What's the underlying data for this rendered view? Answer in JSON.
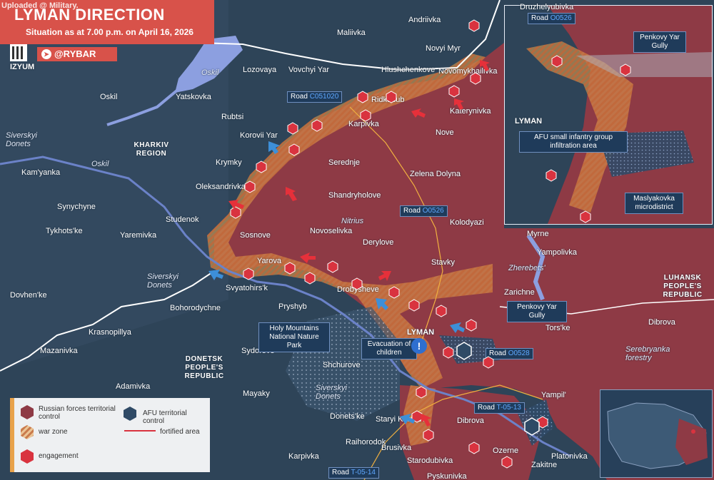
{
  "header": {
    "watermark": "Uploaded @ Military.",
    "title": "LYMAN DIRECTION",
    "subtitle": "Situation as at 7.00 p.m. on April 16, 2026",
    "brand": "@RYBAR",
    "brand_icon": "telegram-icon",
    "qr_icon": "qr-code-icon"
  },
  "colors": {
    "russian_control": "#8e3a45",
    "war_zone": "#e8a24a",
    "afu_control": "#2f4a66",
    "water": "#8c9fe0",
    "engagement": "#d9333f",
    "arrow_ru": "#e6303a",
    "arrow_afu": "#3d8fd8",
    "title_bg": "#d8524a"
  },
  "settlements": [
    {
      "name": "Druzhelyubivka"
    },
    {
      "name": "Andriivka"
    },
    {
      "name": "Maliivka"
    },
    {
      "name": "Novyi Myr"
    },
    {
      "name": "IZYUM"
    },
    {
      "name": "Lozovaya"
    },
    {
      "name": "Vovchyi Yar"
    },
    {
      "name": "Hlushchenkove"
    },
    {
      "name": "Novomykhailivka"
    },
    {
      "name": "Oskil"
    },
    {
      "name": "Yatskovka"
    },
    {
      "name": "Rubtsi"
    },
    {
      "name": "Ridkodub"
    },
    {
      "name": "Katerynivka"
    },
    {
      "name": "Karpivka"
    },
    {
      "name": "Nove"
    },
    {
      "name": "Korovii Yar"
    },
    {
      "name": "Krymky"
    },
    {
      "name": "Serednje"
    },
    {
      "name": "Zelena Dolyna"
    },
    {
      "name": "Kam'yanka"
    },
    {
      "name": "Oleksandrivka"
    },
    {
      "name": "Shandryholove"
    },
    {
      "name": "Synychyne"
    },
    {
      "name": "Tykhots'ke"
    },
    {
      "name": "Studenok"
    },
    {
      "name": "Yaremivka"
    },
    {
      "name": "Kolodyazi"
    },
    {
      "name": "Sosnove"
    },
    {
      "name": "Novoselivka"
    },
    {
      "name": "Derylove"
    },
    {
      "name": "Myrne"
    },
    {
      "name": "Yampolivka"
    },
    {
      "name": "Yarova"
    },
    {
      "name": "Stavky"
    },
    {
      "name": "Svyatohirs'k"
    },
    {
      "name": "Drobysheve"
    },
    {
      "name": "Zarichne"
    },
    {
      "name": "Dovhen'ke"
    },
    {
      "name": "Bohorodychne"
    },
    {
      "name": "Pryshyb"
    },
    {
      "name": "LYMAN"
    },
    {
      "name": "Tors'ke"
    },
    {
      "name": "Dibrova"
    },
    {
      "name": "Krasnopillya"
    },
    {
      "name": "Mazanivka"
    },
    {
      "name": "Sydorove"
    },
    {
      "name": "Shchurove"
    },
    {
      "name": "Adamivka"
    },
    {
      "name": "Mayaky"
    },
    {
      "name": "Yampil'"
    },
    {
      "name": "Donets'ke"
    },
    {
      "name": "Staryi Karavan"
    },
    {
      "name": "Dibrova"
    },
    {
      "name": "Raihorodok"
    },
    {
      "name": "Brusivka"
    },
    {
      "name": "Ozerne"
    },
    {
      "name": "Platonivka"
    },
    {
      "name": "Karpivka"
    },
    {
      "name": "Starodubivka"
    },
    {
      "name": "Zakitne"
    },
    {
      "name": "Pyskunivka"
    }
  ],
  "regions": [
    {
      "name": "KHARKIV REGION"
    },
    {
      "name": "DONETSK PEOPLE'S REPUBLIC"
    },
    {
      "name": "LUHANSK PEOPLE'S REPUBLIC"
    }
  ],
  "rivers": [
    {
      "name": "Oskil"
    },
    {
      "name": "Oskil"
    },
    {
      "name": "Siverskyi Donets"
    },
    {
      "name": "Siverskyi Donets"
    },
    {
      "name": "Siverskyi Donets"
    },
    {
      "name": "Nitrius"
    },
    {
      "name": "Zherebets'"
    }
  ],
  "roads": [
    {
      "prefix": "Road",
      "code": "C051020"
    },
    {
      "prefix": "Road",
      "code": "O0526"
    },
    {
      "prefix": "Road",
      "code": "O0528"
    },
    {
      "prefix": "Road",
      "code": "T-05-13"
    },
    {
      "prefix": "Road",
      "code": "T-05-14"
    }
  ],
  "callouts": {
    "park": "Holy Mountains National Nature Park",
    "evacuation": "Evacuation of children",
    "penkovy_main": "Penkovy Yar Gully",
    "forestry": "Serebryanka forestry"
  },
  "inset": {
    "road_prefix": "Road",
    "road_code": "O0526",
    "penkovy": "Penkovy Yar Gully",
    "lyman": "LYMAN",
    "infiltration": "AFU small infantry group infiltration area",
    "maslyakovka": "Maslyakovka microdistrict"
  },
  "legend": {
    "russian": "Russian forces territorial control",
    "afu": "AFU territorial control",
    "war_zone": "war zone",
    "fortified": "fortified area",
    "engagement": "engagement"
  }
}
